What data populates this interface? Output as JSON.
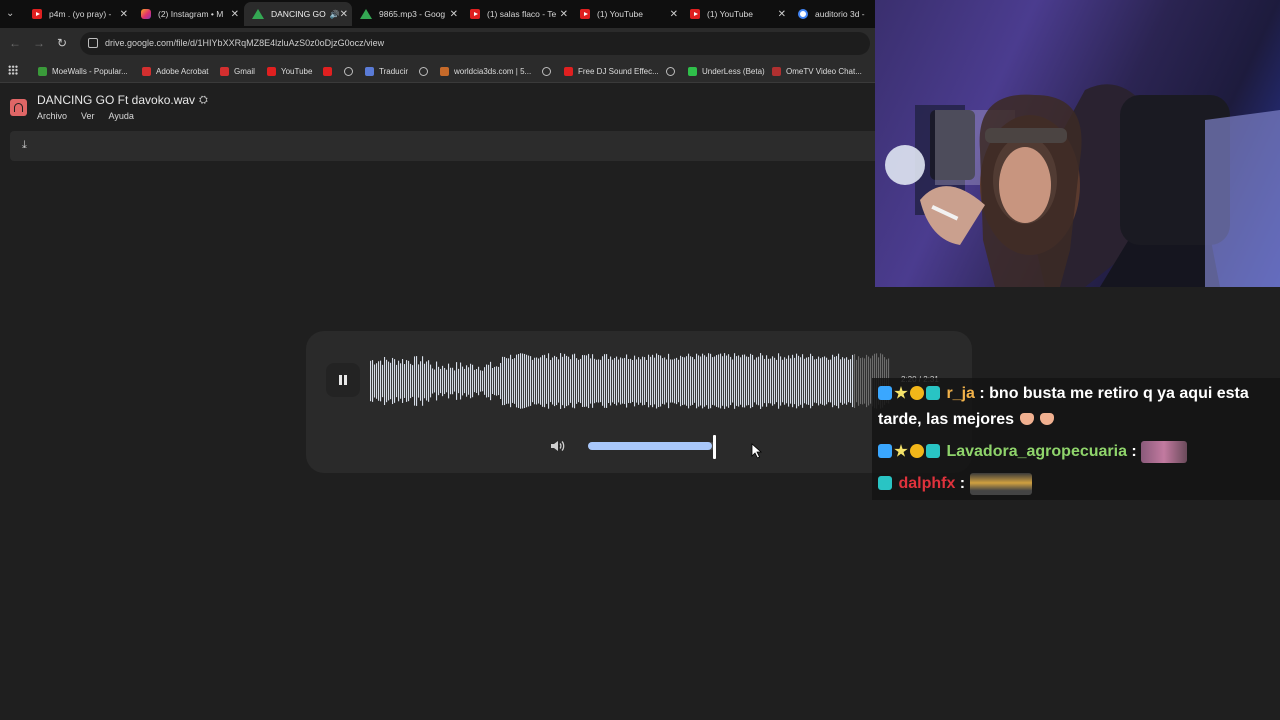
{
  "browser": {
    "tabs": [
      {
        "title": "p4m . (yo pray) -",
        "favicon": "youtube-icon",
        "active": false
      },
      {
        "title": "(2) Instagram • M",
        "favicon": "instagram-icon",
        "active": false
      },
      {
        "title": "DANCING GO",
        "favicon": "drive-icon",
        "active": true,
        "audio": true
      },
      {
        "title": "9865.mp3 - Goog",
        "favicon": "drive-icon",
        "active": false
      },
      {
        "title": "(1) salas flaco - Te",
        "favicon": "youtube-icon",
        "active": false
      },
      {
        "title": "(1) YouTube",
        "favicon": "youtube-icon",
        "active": false
      },
      {
        "title": "(1) YouTube",
        "favicon": "youtube-icon",
        "active": false
      },
      {
        "title": "auditorio 3d - Bu",
        "favicon": "google-icon",
        "active": false
      }
    ],
    "url": "drive.google.com/file/d/1HIYbXXRqMZ8E4lzluAzS0z0oDjzG0ocz/view",
    "bookmarks": [
      {
        "label": "MoeWalls - Popular...",
        "icon": "green"
      },
      {
        "label": "Adobe Acrobat",
        "icon": "red"
      },
      {
        "label": "Gmail",
        "icon": "red"
      },
      {
        "label": "YouTube",
        "icon": "yt"
      },
      {
        "label": "",
        "icon": "yt"
      },
      {
        "label": "",
        "icon": "globe"
      },
      {
        "label": "Traducir",
        "icon": "blue"
      },
      {
        "label": "",
        "icon": "globe"
      },
      {
        "label": "worldcia3ds.com | 5...",
        "icon": "orange"
      },
      {
        "label": "",
        "icon": "globe"
      },
      {
        "label": "Free DJ Sound Effec...",
        "icon": "yt"
      },
      {
        "label": "",
        "icon": "globe"
      },
      {
        "label": "UnderLess (Beta)",
        "icon": "lime"
      },
      {
        "label": "OmeTV Video Chat...",
        "icon": "tv"
      }
    ]
  },
  "drive": {
    "file_title": "DANCING GO Ft davoko.wav",
    "menu": [
      "Archivo",
      "Ver",
      "Ayuda"
    ]
  },
  "player": {
    "time": "2:20 / 2:31",
    "progress": 0.93,
    "volume": 0.98
  },
  "chat": [
    {
      "user": "r_ja",
      "message": "bno busta me retiro q ya aqui esta tarde, las mejores"
    },
    {
      "user": "Lavadora_agropecuaria",
      "message": ""
    },
    {
      "user": "dalphfx",
      "message": ""
    }
  ],
  "colors": {
    "accent": "#a8c7fa",
    "background": "#1f1f1f"
  }
}
